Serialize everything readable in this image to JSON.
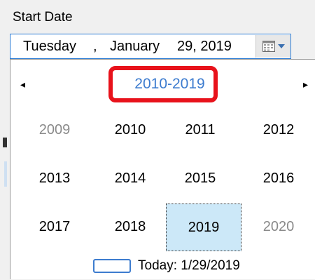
{
  "field": {
    "label": "Start Date",
    "date": {
      "weekday": "Tuesday",
      "sep1": ",",
      "month": "January",
      "day_year": "29, 2019"
    }
  },
  "calendar": {
    "prev_glyph": "◂",
    "next_glyph": "▸",
    "header": "2010-2019",
    "years": [
      {
        "label": "2009",
        "dim": true
      },
      {
        "label": "2010",
        "dim": false
      },
      {
        "label": "2011",
        "dim": false
      },
      {
        "label": "2012",
        "dim": false
      },
      {
        "label": "2013",
        "dim": false
      },
      {
        "label": "2014",
        "dim": false
      },
      {
        "label": "2015",
        "dim": false
      },
      {
        "label": "2016",
        "dim": false
      },
      {
        "label": "2017",
        "dim": false
      },
      {
        "label": "2018",
        "dim": false
      },
      {
        "label": "2019",
        "dim": false,
        "selected": true
      },
      {
        "label": "2020",
        "dim": true
      }
    ],
    "today": "Today: 1/29/2019"
  },
  "colors": {
    "accent": "#3d7ccf",
    "highlight": "#e8121b",
    "selected_bg": "#cce8f8"
  }
}
